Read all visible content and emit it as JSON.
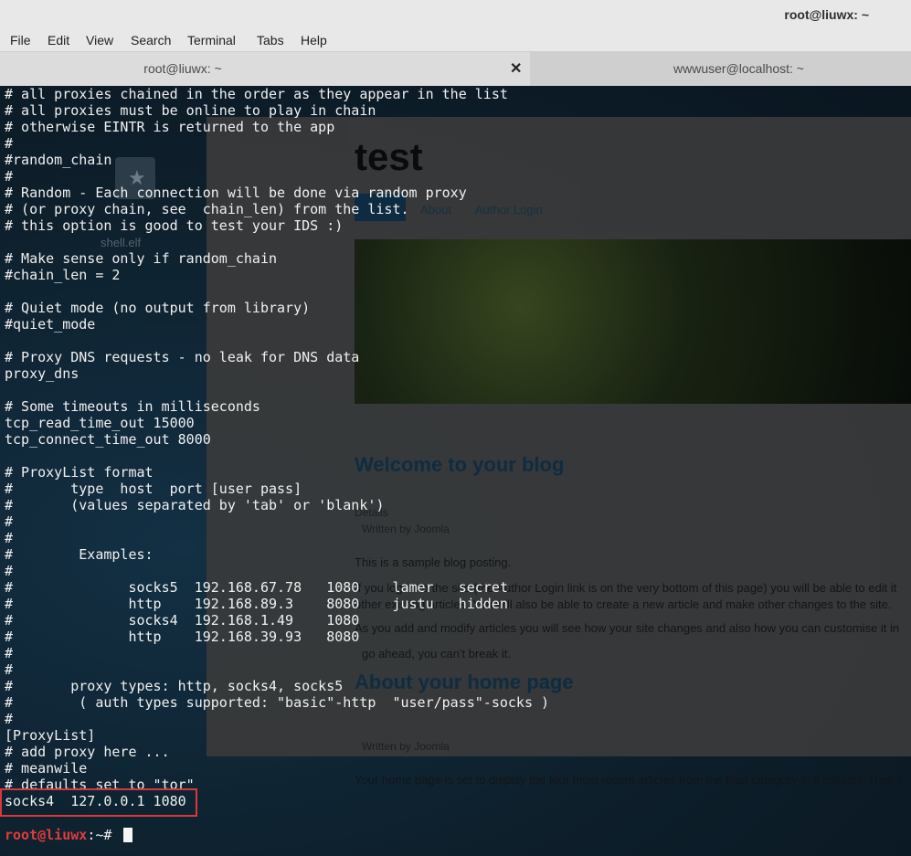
{
  "window": {
    "title": "root@liuwx: ~"
  },
  "menu": [
    "File",
    "Edit",
    "View",
    "Search",
    "Terminal",
    "Tabs",
    "Help"
  ],
  "tabs": [
    {
      "label": "root@liuwx: ~",
      "active": true
    },
    {
      "label": "wwwuser@localhost: ~",
      "active": false
    }
  ],
  "desktop": {
    "icon_label": "shell.elf"
  },
  "blog": {
    "title": "test",
    "nav": [
      "About",
      "Author Login"
    ],
    "heading1": "Welcome to your blog",
    "meta1": "Details",
    "meta2": "Written by Joomla",
    "p1": "This is a sample blog posting.",
    "p2a": "If you log in to the site (the Author Login link is on the very bottom of this page) you will be able to edit it",
    "p2b": "other existing articles. You will also be able to create a new article and make other changes to the site.",
    "p3a": "As you add and modify articles you will see how your site changes and also how you can customise it in",
    "p3b": "go ahead, you can't break it.",
    "heading2": "About your home page",
    "meta3": "Written by Joomla",
    "p4": "Your home page is set to display the four most recent articles from the blog category in a column. Then t"
  },
  "terminal": {
    "lines": [
      "# all proxies chained in the order as they appear in the list",
      "# all proxies must be online to play in chain",
      "# otherwise EINTR is returned to the app",
      "#",
      "#random_chain",
      "#",
      "# Random - Each connection will be done via random proxy",
      "# (or proxy chain, see  chain_len) from the list.",
      "# this option is good to test your IDS :)",
      "",
      "# Make sense only if random_chain",
      "#chain_len = 2",
      "",
      "# Quiet mode (no output from library)",
      "#quiet_mode",
      "",
      "# Proxy DNS requests - no leak for DNS data",
      "proxy_dns",
      "",
      "# Some timeouts in milliseconds",
      "tcp_read_time_out 15000",
      "tcp_connect_time_out 8000",
      "",
      "# ProxyList format",
      "#       type  host  port [user pass]",
      "#       (values separated by 'tab' or 'blank')",
      "#",
      "#",
      "#        Examples:",
      "#",
      "#              socks5  192.168.67.78   1080    lamer   secret",
      "#              http    192.168.89.3    8080    justu   hidden",
      "#              socks4  192.168.1.49    1080",
      "#              http    192.168.39.93   8080",
      "#",
      "#",
      "#       proxy types: http, socks4, socks5",
      "#        ( auth types supported: \"basic\"-http  \"user/pass\"-socks )",
      "#",
      "[ProxyList]",
      "# add proxy here ...",
      "# meanwile",
      "# defaults set to \"tor\"",
      "socks4  127.0.0.1 1080"
    ],
    "prompt_user": "root@liuwx",
    "prompt_path": ":~# "
  }
}
